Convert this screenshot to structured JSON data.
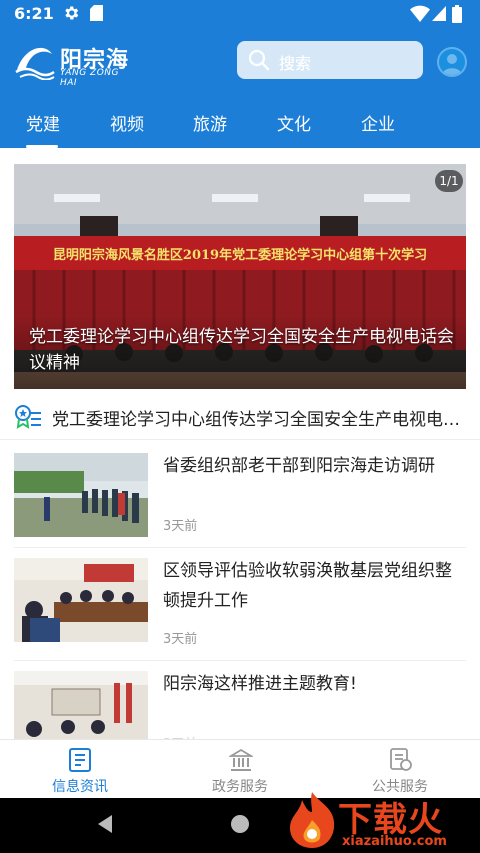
{
  "status_bar": {
    "time": "6:21"
  },
  "header": {
    "logo_name": "阳宗海",
    "logo_sub": "YANG ZONG HAI",
    "search_placeholder": "搜索"
  },
  "tabs": [
    {
      "label": "党建",
      "active": true
    },
    {
      "label": "视频",
      "active": false
    },
    {
      "label": "旅游",
      "active": false
    },
    {
      "label": "文化",
      "active": false
    },
    {
      "label": "企业",
      "active": false
    }
  ],
  "banner": {
    "counter": "1/1",
    "caption": "党工委理论学习中心组传达学习全国安全生产电视电话会议精神",
    "photo_banner_text": "昆明阳宗海风景名胜区2019年党工委理论学习中心组第十次学习"
  },
  "notice": {
    "text": "党工委理论学习中心组传达学习全国安全生产电视电话会议精神"
  },
  "news": [
    {
      "title": "省委组织部老干部到阳宗海走访调研",
      "time": "3天前"
    },
    {
      "title": "区领导评估验收软弱涣散基层党组织整顿提升工作",
      "time": "3天前"
    },
    {
      "title": "阳宗海这样推进主题教育!",
      "time": "3天前"
    }
  ],
  "bottom_nav": [
    {
      "label": "信息资讯",
      "active": true
    },
    {
      "label": "政务服务",
      "active": false
    },
    {
      "label": "公共服务",
      "active": false
    }
  ],
  "watermark": {
    "big": "下载火",
    "small": "xiazaihuo.com"
  },
  "colors": {
    "primary": "#1c7ed6",
    "watermark": "#e8471e"
  }
}
